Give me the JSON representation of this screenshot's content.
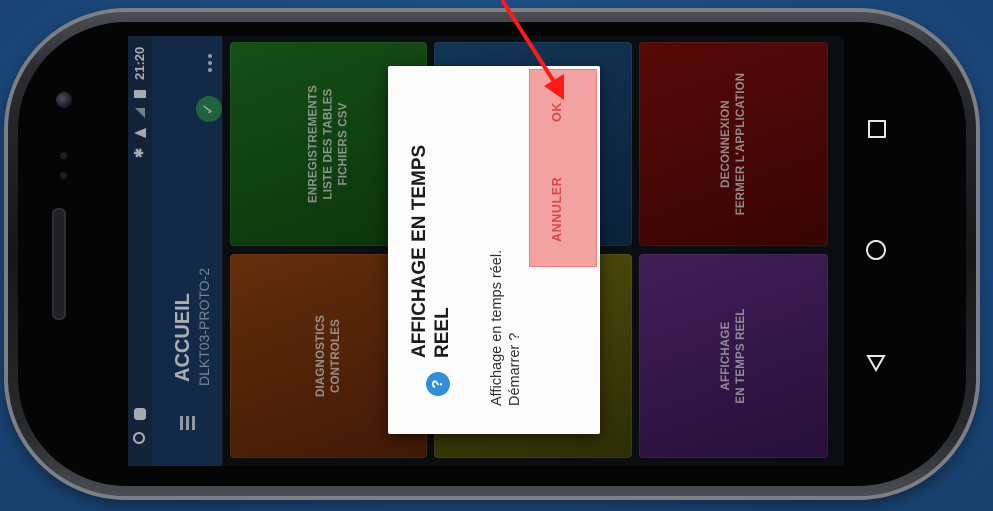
{
  "status_bar": {
    "time": "21:20"
  },
  "app_bar": {
    "title": "ACCUEIL",
    "subtitle": "DLKT03-PROTO-2"
  },
  "tiles": [
    {
      "lines": [
        "ENREGISTREMENTS",
        "LISTE DES TABLES",
        "FICHIERS CSV"
      ]
    },
    {
      "lines": [
        "DECONNEXION",
        "FERMER L'APPLICATION"
      ]
    },
    {
      "lines": [
        "DIAGNOSTICS",
        "CONTROLES"
      ]
    },
    {
      "lines": [
        "AFFICHAGE",
        "EN TEMPS REEL"
      ]
    }
  ],
  "dialog": {
    "title_line1": "AFFICHAGE EN TEMPS",
    "title_line2": "REEL",
    "message_line1": "Affichage en temps réel.",
    "message_line2": "Démarrer ?",
    "cancel_label": "ANNULER",
    "ok_label": "OK"
  },
  "colors": {
    "accent": "#d74a4a",
    "app_bar": "#1a3a63",
    "annotation_arrow": "#ff1a1a"
  },
  "icons": [
    "menu-icon",
    "check-icon",
    "overflow-icon",
    "help-icon",
    "bluetooth-icon",
    "wifi-icon",
    "signal-icon",
    "battery-icon",
    "android-icon",
    "nav-back-icon",
    "nav-home-icon",
    "nav-recents-icon"
  ]
}
